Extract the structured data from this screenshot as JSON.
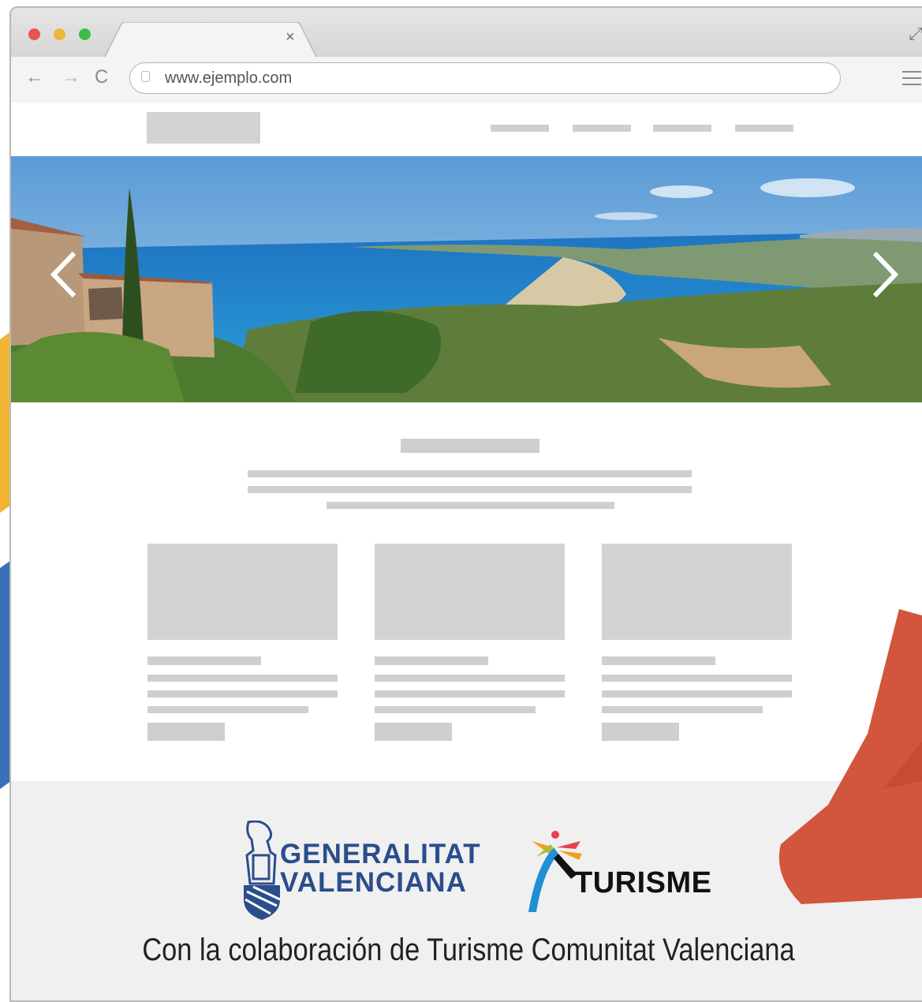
{
  "browser": {
    "url": "www.ejemplo.com",
    "tab_close": "×",
    "back_icon": "←",
    "forward_icon": "→",
    "reload_icon": "C",
    "expand_icon": "⤢"
  },
  "carousel": {
    "prev_icon": "chevron-left-icon",
    "next_icon": "chevron-right-icon"
  },
  "footer": {
    "gv_line1": "GENERALITAT",
    "gv_line2": "VALENCIANA",
    "turisme": "TURISME",
    "collaboration": "Con la colaboración de Turisme Comunitat Valenciana"
  },
  "colors": {
    "gv_blue": "#2b4d8c",
    "deco_red": "#d2553d",
    "deco_yellow": "#f2b634",
    "deco_blue": "#3a70b5"
  }
}
